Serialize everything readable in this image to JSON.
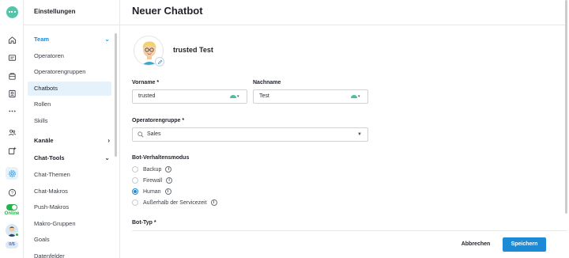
{
  "colors": {
    "accent": "#1d8ad6",
    "online": "#28b24b",
    "brand": "#54c6a8"
  },
  "rail": {
    "icons": [
      "logo-icon",
      "home-icon",
      "chat-icon",
      "inbox-icon",
      "contacts-icon",
      "more-icon",
      "team-icon",
      "add-channel-icon",
      "settings-icon",
      "help-icon"
    ],
    "online_label": "Online",
    "capacity": "0/5"
  },
  "sidebar": {
    "title": "Einstellungen",
    "groups": {
      "team": "Team",
      "kanaele": "Kanäle",
      "chat_tools": "Chat-Tools"
    },
    "team_items": [
      "Operatoren",
      "Operatorengruppen",
      "Chatbots",
      "Rollen",
      "Skills"
    ],
    "chat_tools_items": [
      "Chat-Themen",
      "Chat-Makros",
      "Push-Makros",
      "Makro-Gruppen",
      "Goals",
      "Datenfelder"
    ]
  },
  "main": {
    "title": "Neuer Chatbot",
    "bot_name": "trusted Test",
    "vorname_label": "Vorname *",
    "vorname_value": "trusted",
    "nachname_label": "Nachname",
    "nachname_value": "Test",
    "group_label": "Operatorengruppe *",
    "group_value": "Sales",
    "mode_label": "Bot-Verhaltensmodus",
    "modes": [
      "Backup",
      "Firewall",
      "Human",
      "Außerhalb der Servicezeit"
    ],
    "selected_mode": "Human",
    "type_label": "Bot-Typ *"
  },
  "footer": {
    "cancel": "Abbrechen",
    "save": "Speichern"
  }
}
